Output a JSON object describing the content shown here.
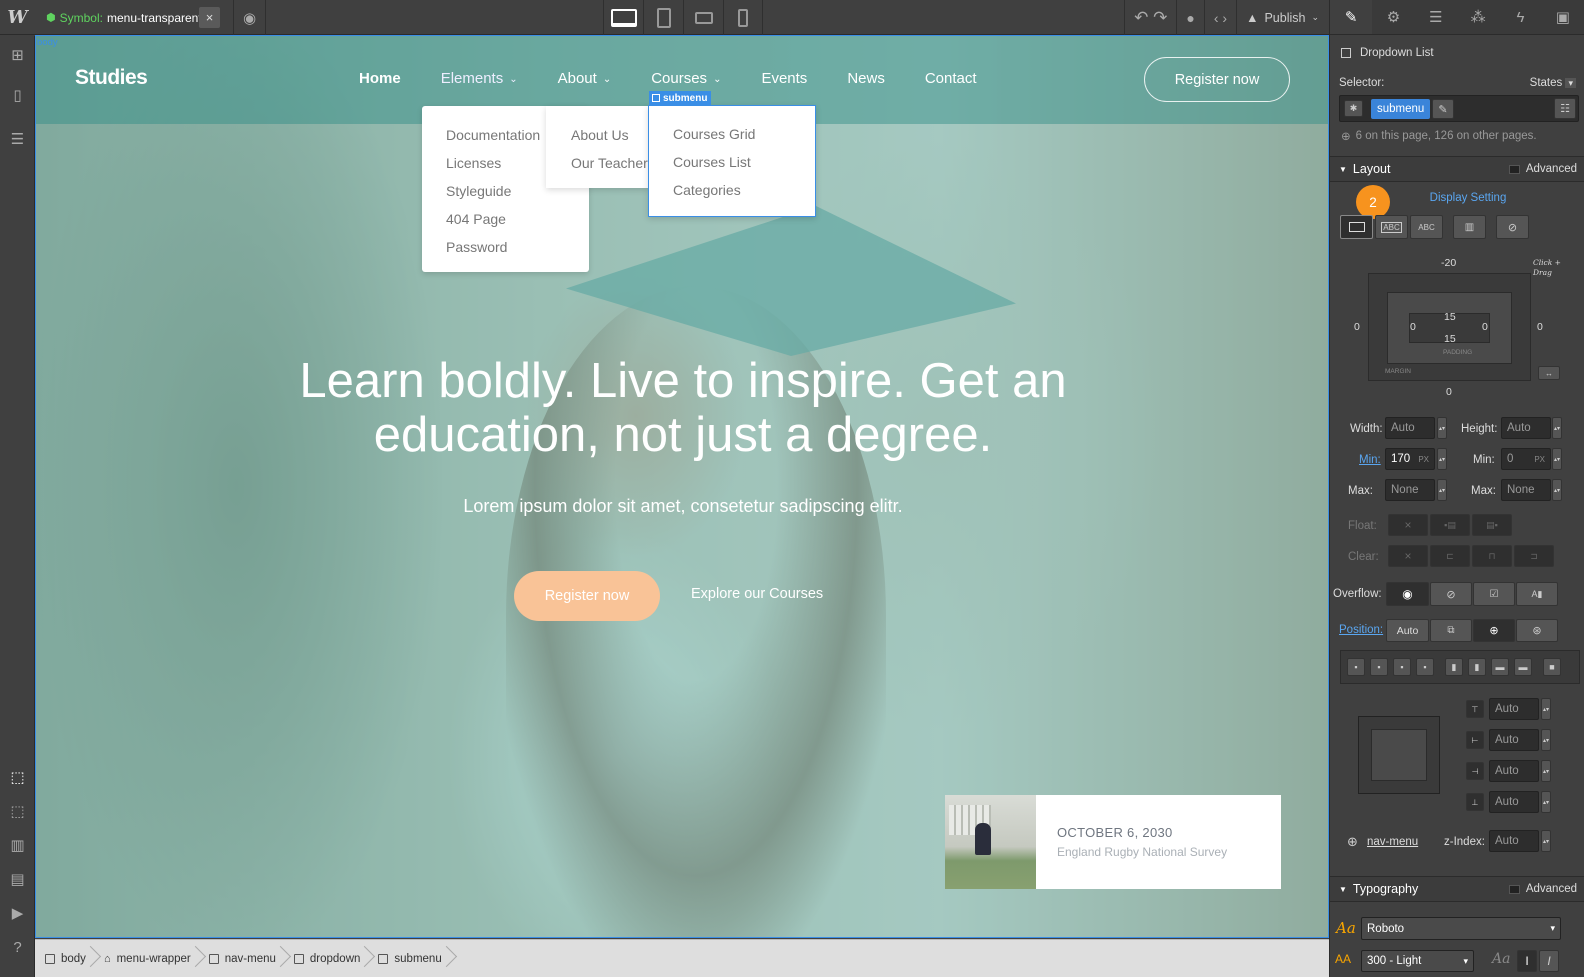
{
  "topbar": {
    "symbol_label": "Symbol:",
    "symbol_name": "menu-transparent",
    "close": "×",
    "publish": "Publish"
  },
  "canvas": {
    "body_tag": "body",
    "brand": "Studies",
    "nav": [
      "Home",
      "Elements",
      "About",
      "Courses",
      "Events",
      "News",
      "Contact"
    ],
    "register_top": "Register now",
    "submenu_tag": "submenu",
    "elements_menu": [
      "Documentation",
      "Licenses",
      "Styleguide",
      "404 Page",
      "Password"
    ],
    "about_menu": [
      "About Us",
      "Our Teacher"
    ],
    "courses_menu": [
      "Courses Grid",
      "Courses List",
      "Categories"
    ],
    "headline_1": "Learn boldly. Live to inspire. Get an",
    "headline_2": "education, not just a degree.",
    "subtitle": "Lorem ipsum dolor sit amet, consetetur sadipscing elitr.",
    "register_main": "Register now",
    "explore": "Explore our Courses",
    "event_date": "OCTOBER 6, 2030",
    "event_desc": "England Rugby National Survey"
  },
  "breadcrumbs": [
    "body",
    "menu-wrapper",
    "nav-menu",
    "dropdown",
    "submenu"
  ],
  "panel": {
    "element_type": "Dropdown List",
    "selector_label": "Selector:",
    "states_label": "States",
    "selector_class": "submenu",
    "usage": "6 on this page, 126 on other pages.",
    "layout_title": "Layout",
    "advanced": "Advanced",
    "badge": "2",
    "display_setting": "Display Setting",
    "margin_top": "-20",
    "margin_left": "0",
    "margin_right": "0",
    "margin_bottom": "0",
    "padding_top": "15",
    "padding_left": "0",
    "padding_right": "0",
    "padding_bottom": "15",
    "padding_label": "PADDING",
    "margin_label": "MARGIN",
    "click_drag": "Click + Drag",
    "width_label": "Width:",
    "width_val": "Auto",
    "height_label": "Height:",
    "height_val": "Auto",
    "min_label": "Min:",
    "min_w": "170",
    "min_w_unit": "PX",
    "min_h": "0",
    "min_h_unit": "PX",
    "max_label": "Max:",
    "max_w": "None",
    "max_h": "None",
    "float_label": "Float:",
    "clear_label": "Clear:",
    "overflow_label": "Overflow:",
    "position_label": "Position:",
    "position_val": "Auto",
    "pos_top": "Auto",
    "pos_left": "Auto",
    "pos_right": "Auto",
    "pos_bottom": "Auto",
    "relative_to": "nav-menu",
    "zindex_label": "z-Index:",
    "zindex_val": "Auto",
    "typography_title": "Typography",
    "font": "Roboto",
    "weight": "300 - Light"
  }
}
